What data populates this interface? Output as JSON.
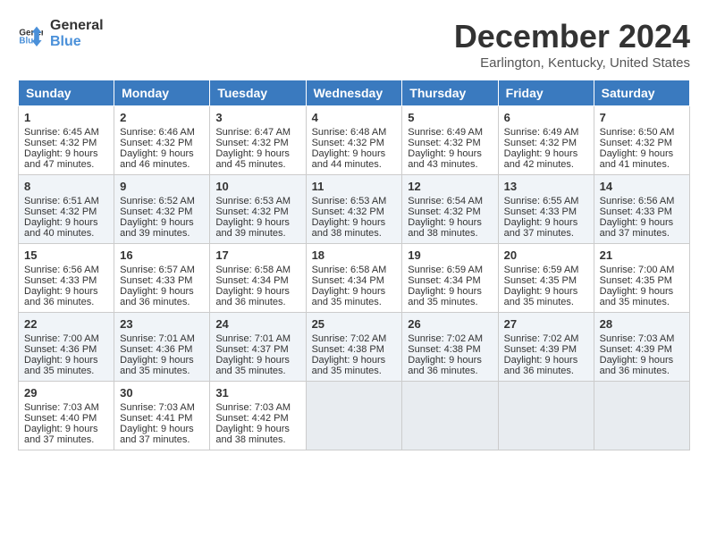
{
  "logo": {
    "line1": "General",
    "line2": "Blue"
  },
  "title": "December 2024",
  "location": "Earlington, Kentucky, United States",
  "days_header": [
    "Sunday",
    "Monday",
    "Tuesday",
    "Wednesday",
    "Thursday",
    "Friday",
    "Saturday"
  ],
  "weeks": [
    [
      {
        "day": "1",
        "sunrise": "Sunrise: 6:45 AM",
        "sunset": "Sunset: 4:32 PM",
        "daylight": "Daylight: 9 hours and 47 minutes."
      },
      {
        "day": "2",
        "sunrise": "Sunrise: 6:46 AM",
        "sunset": "Sunset: 4:32 PM",
        "daylight": "Daylight: 9 hours and 46 minutes."
      },
      {
        "day": "3",
        "sunrise": "Sunrise: 6:47 AM",
        "sunset": "Sunset: 4:32 PM",
        "daylight": "Daylight: 9 hours and 45 minutes."
      },
      {
        "day": "4",
        "sunrise": "Sunrise: 6:48 AM",
        "sunset": "Sunset: 4:32 PM",
        "daylight": "Daylight: 9 hours and 44 minutes."
      },
      {
        "day": "5",
        "sunrise": "Sunrise: 6:49 AM",
        "sunset": "Sunset: 4:32 PM",
        "daylight": "Daylight: 9 hours and 43 minutes."
      },
      {
        "day": "6",
        "sunrise": "Sunrise: 6:49 AM",
        "sunset": "Sunset: 4:32 PM",
        "daylight": "Daylight: 9 hours and 42 minutes."
      },
      {
        "day": "7",
        "sunrise": "Sunrise: 6:50 AM",
        "sunset": "Sunset: 4:32 PM",
        "daylight": "Daylight: 9 hours and 41 minutes."
      }
    ],
    [
      {
        "day": "8",
        "sunrise": "Sunrise: 6:51 AM",
        "sunset": "Sunset: 4:32 PM",
        "daylight": "Daylight: 9 hours and 40 minutes."
      },
      {
        "day": "9",
        "sunrise": "Sunrise: 6:52 AM",
        "sunset": "Sunset: 4:32 PM",
        "daylight": "Daylight: 9 hours and 39 minutes."
      },
      {
        "day": "10",
        "sunrise": "Sunrise: 6:53 AM",
        "sunset": "Sunset: 4:32 PM",
        "daylight": "Daylight: 9 hours and 39 minutes."
      },
      {
        "day": "11",
        "sunrise": "Sunrise: 6:53 AM",
        "sunset": "Sunset: 4:32 PM",
        "daylight": "Daylight: 9 hours and 38 minutes."
      },
      {
        "day": "12",
        "sunrise": "Sunrise: 6:54 AM",
        "sunset": "Sunset: 4:32 PM",
        "daylight": "Daylight: 9 hours and 38 minutes."
      },
      {
        "day": "13",
        "sunrise": "Sunrise: 6:55 AM",
        "sunset": "Sunset: 4:33 PM",
        "daylight": "Daylight: 9 hours and 37 minutes."
      },
      {
        "day": "14",
        "sunrise": "Sunrise: 6:56 AM",
        "sunset": "Sunset: 4:33 PM",
        "daylight": "Daylight: 9 hours and 37 minutes."
      }
    ],
    [
      {
        "day": "15",
        "sunrise": "Sunrise: 6:56 AM",
        "sunset": "Sunset: 4:33 PM",
        "daylight": "Daylight: 9 hours and 36 minutes."
      },
      {
        "day": "16",
        "sunrise": "Sunrise: 6:57 AM",
        "sunset": "Sunset: 4:33 PM",
        "daylight": "Daylight: 9 hours and 36 minutes."
      },
      {
        "day": "17",
        "sunrise": "Sunrise: 6:58 AM",
        "sunset": "Sunset: 4:34 PM",
        "daylight": "Daylight: 9 hours and 36 minutes."
      },
      {
        "day": "18",
        "sunrise": "Sunrise: 6:58 AM",
        "sunset": "Sunset: 4:34 PM",
        "daylight": "Daylight: 9 hours and 35 minutes."
      },
      {
        "day": "19",
        "sunrise": "Sunrise: 6:59 AM",
        "sunset": "Sunset: 4:34 PM",
        "daylight": "Daylight: 9 hours and 35 minutes."
      },
      {
        "day": "20",
        "sunrise": "Sunrise: 6:59 AM",
        "sunset": "Sunset: 4:35 PM",
        "daylight": "Daylight: 9 hours and 35 minutes."
      },
      {
        "day": "21",
        "sunrise": "Sunrise: 7:00 AM",
        "sunset": "Sunset: 4:35 PM",
        "daylight": "Daylight: 9 hours and 35 minutes."
      }
    ],
    [
      {
        "day": "22",
        "sunrise": "Sunrise: 7:00 AM",
        "sunset": "Sunset: 4:36 PM",
        "daylight": "Daylight: 9 hours and 35 minutes."
      },
      {
        "day": "23",
        "sunrise": "Sunrise: 7:01 AM",
        "sunset": "Sunset: 4:36 PM",
        "daylight": "Daylight: 9 hours and 35 minutes."
      },
      {
        "day": "24",
        "sunrise": "Sunrise: 7:01 AM",
        "sunset": "Sunset: 4:37 PM",
        "daylight": "Daylight: 9 hours and 35 minutes."
      },
      {
        "day": "25",
        "sunrise": "Sunrise: 7:02 AM",
        "sunset": "Sunset: 4:38 PM",
        "daylight": "Daylight: 9 hours and 35 minutes."
      },
      {
        "day": "26",
        "sunrise": "Sunrise: 7:02 AM",
        "sunset": "Sunset: 4:38 PM",
        "daylight": "Daylight: 9 hours and 36 minutes."
      },
      {
        "day": "27",
        "sunrise": "Sunrise: 7:02 AM",
        "sunset": "Sunset: 4:39 PM",
        "daylight": "Daylight: 9 hours and 36 minutes."
      },
      {
        "day": "28",
        "sunrise": "Sunrise: 7:03 AM",
        "sunset": "Sunset: 4:39 PM",
        "daylight": "Daylight: 9 hours and 36 minutes."
      }
    ],
    [
      {
        "day": "29",
        "sunrise": "Sunrise: 7:03 AM",
        "sunset": "Sunset: 4:40 PM",
        "daylight": "Daylight: 9 hours and 37 minutes."
      },
      {
        "day": "30",
        "sunrise": "Sunrise: 7:03 AM",
        "sunset": "Sunset: 4:41 PM",
        "daylight": "Daylight: 9 hours and 37 minutes."
      },
      {
        "day": "31",
        "sunrise": "Sunrise: 7:03 AM",
        "sunset": "Sunset: 4:42 PM",
        "daylight": "Daylight: 9 hours and 38 minutes."
      },
      null,
      null,
      null,
      null
    ]
  ]
}
